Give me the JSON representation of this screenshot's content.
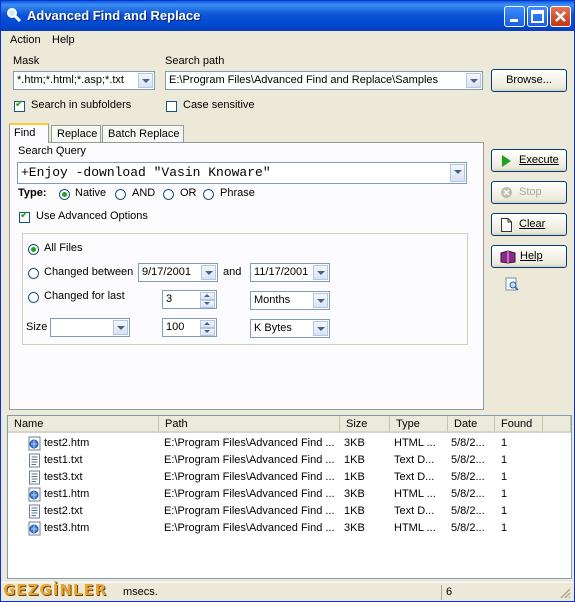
{
  "window": {
    "title": "Advanced Find and Replace"
  },
  "menu": {
    "action": "Action",
    "help": "Help"
  },
  "mask": {
    "label": "Mask",
    "value": "*.htm;*.html;*.asp;*.txt"
  },
  "search_path": {
    "label": "Search path",
    "value": "E:\\Program Files\\Advanced Find and Replace\\Samples"
  },
  "browse_button": "Browse...",
  "options": {
    "subfolders": "Search in subfolders",
    "subfolders_checked": true,
    "case_sensitive": "Case sensitive",
    "case_checked": false
  },
  "tabs": [
    "Find",
    "Replace",
    "Batch Replace"
  ],
  "find": {
    "query_label": "Search Query",
    "query_value": "+Enjoy -download \"Vasin Knoware\"",
    "type_label": "Type:",
    "types": [
      "Native",
      "AND",
      "OR",
      "Phrase"
    ],
    "selected_type": "Native",
    "advanced_label": "Use Advanced Options",
    "all_files": "All Files",
    "changed_between": "Changed between",
    "date_from": "9/17/2001",
    "and_label": "and",
    "date_to": "11/17/2001",
    "changed_for_last": "Changed for last",
    "last_value": "3",
    "last_unit": "Months",
    "size_label": "Size",
    "size_op": "",
    "size_value": "100",
    "size_unit": "K Bytes"
  },
  "buttons": {
    "execute": "Execute",
    "stop": "Stop",
    "clear": "Clear",
    "help": "Help"
  },
  "results": {
    "columns": [
      "Name",
      "Path",
      "Size",
      "Type",
      "Date",
      "Found"
    ],
    "rows": [
      {
        "name": "test2.htm",
        "path": "E:\\Program Files\\Advanced Find ...",
        "size": "3KB",
        "type": "HTML ...",
        "date": "5/8/2...",
        "found": "1",
        "icon": "html-file-icon"
      },
      {
        "name": "test1.txt",
        "path": "E:\\Program Files\\Advanced Find ...",
        "size": "1KB",
        "type": "Text D...",
        "date": "5/8/2...",
        "found": "1",
        "icon": "text-file-icon"
      },
      {
        "name": "test3.txt",
        "path": "E:\\Program Files\\Advanced Find ...",
        "size": "1KB",
        "type": "Text D...",
        "date": "5/8/2...",
        "found": "1",
        "icon": "text-file-icon"
      },
      {
        "name": "test1.htm",
        "path": "E:\\Program Files\\Advanced Find ...",
        "size": "3KB",
        "type": "HTML ...",
        "date": "5/8/2...",
        "found": "1",
        "icon": "html-file-icon"
      },
      {
        "name": "test2.txt",
        "path": "E:\\Program Files\\Advanced Find ...",
        "size": "1KB",
        "type": "Text D...",
        "date": "5/8/2...",
        "found": "1",
        "icon": "text-file-icon"
      },
      {
        "name": "test3.htm",
        "path": "E:\\Program Files\\Advanced Find ...",
        "size": "3KB",
        "type": "HTML ...",
        "date": "5/8/2...",
        "found": "1",
        "icon": "html-file-icon"
      }
    ]
  },
  "status": {
    "time": "msecs.",
    "count": "6"
  },
  "watermark": "GEZGİNLER",
  "colors": {
    "titlebar": "#0a5bdc",
    "accent_green": "#21a121"
  }
}
